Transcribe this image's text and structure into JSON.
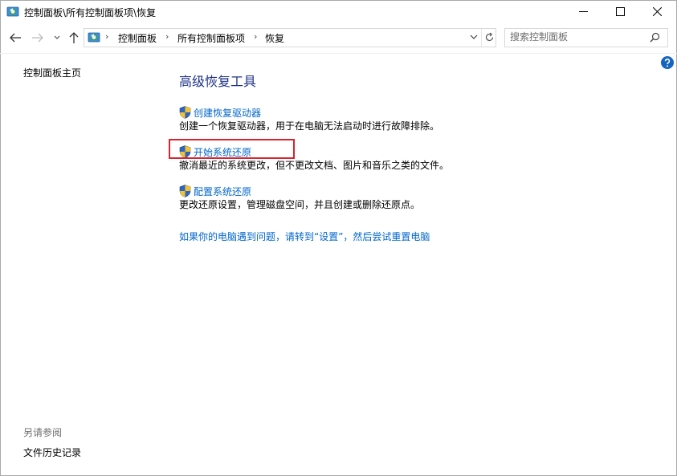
{
  "window": {
    "title": "控制面板\\所有控制面板项\\恢复"
  },
  "breadcrumb": {
    "items": [
      "控制面板",
      "所有控制面板项",
      "恢复"
    ]
  },
  "search": {
    "placeholder": "搜索控制面板"
  },
  "left_panel": {
    "home": "控制面板主页",
    "see_also": "另请参阅",
    "file_history": "文件历史记录"
  },
  "main": {
    "heading": "高级恢复工具",
    "tasks": [
      {
        "link": "创建恢复驱动器",
        "desc": "创建一个恢复驱动器，用于在电脑无法启动时进行故障排除。"
      },
      {
        "link": "开始系统还原",
        "desc": "撤消最近的系统更改，但不更改文档、图片和音乐之类的文件。"
      },
      {
        "link": "配置系统还原",
        "desc": "更改还原设置，管理磁盘空间，并且创建或删除还原点。"
      }
    ],
    "reset_link": "如果你的电脑遇到问题，请转到“设置”，然后尝试重置电脑"
  },
  "colors": {
    "link": "#0066cc",
    "heading": "#1e3287",
    "highlight": "#d9232e",
    "help": "#1565c0"
  },
  "icons": {
    "app": "control-panel-recovery-icon",
    "task": "uac-shield-icon",
    "help": "help-icon",
    "search": "search-icon"
  }
}
